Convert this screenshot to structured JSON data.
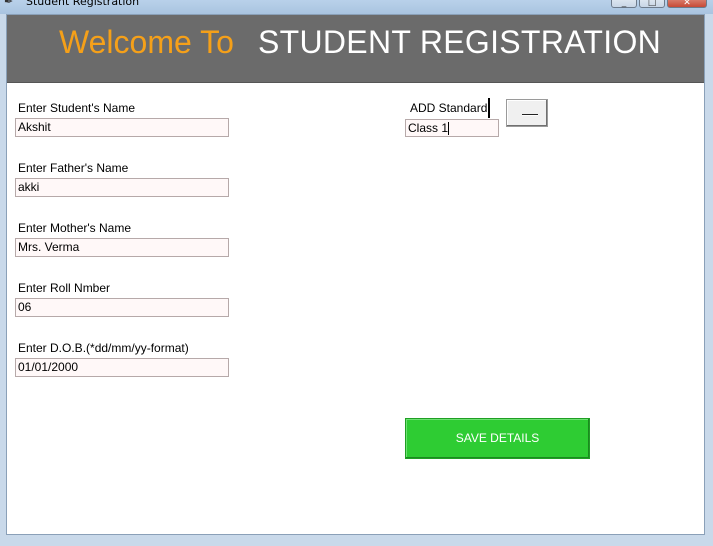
{
  "window": {
    "title": "Student Registration",
    "minimize_symbol": "_",
    "maximize_symbol": "□",
    "close_symbol": "✕"
  },
  "banner": {
    "welcome": "Welcome To",
    "title": "STUDENT REGISTRATION",
    "background": "#6b6b6b",
    "welcome_color": "#f5a019",
    "title_color": "#ffffff"
  },
  "form": {
    "student_name": {
      "label": "Enter Student's Name",
      "value": "Akshit"
    },
    "father_name": {
      "label": "Enter Father's Name",
      "value": "akki"
    },
    "mother_name": {
      "label": "Enter Mother's Name",
      "value": "Mrs. Verma"
    },
    "roll_number": {
      "label": "Enter Roll Nmber",
      "value": "06"
    },
    "dob": {
      "label": "Enter D.O.B.(*dd/mm/yy-format)",
      "value": "01/01/2000"
    }
  },
  "standard": {
    "label": "ADD Standard",
    "value": "Class 1",
    "dropdown_icon": "dropdown-menu-icon"
  },
  "actions": {
    "save_label": "SAVE DETAILS",
    "save_color": "#2ecc33"
  }
}
